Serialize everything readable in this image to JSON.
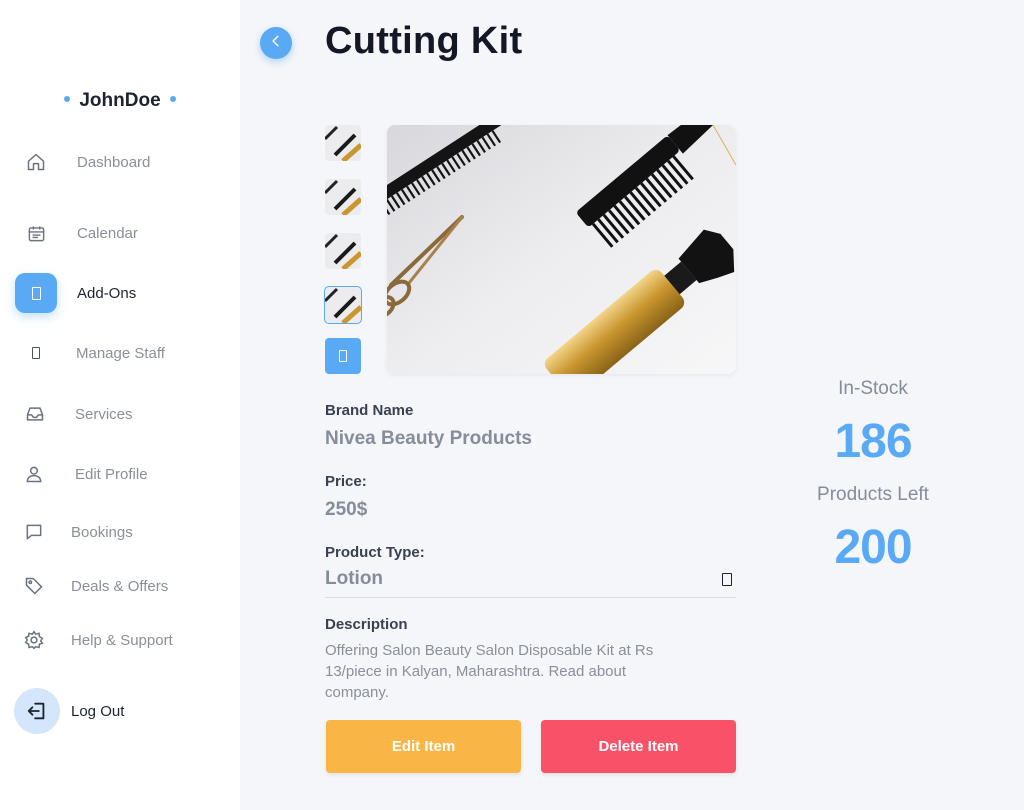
{
  "sidebar": {
    "user_name": "JohnDoe",
    "items": [
      {
        "label": "Dashboard",
        "icon": "home-icon"
      },
      {
        "label": "Calendar",
        "icon": "calendar-icon"
      },
      {
        "label": "Add-Ons",
        "icon": "add-ons-icon",
        "active": true
      },
      {
        "label": "Manage Staff",
        "icon": "staff-icon"
      },
      {
        "label": "Services",
        "icon": "inbox-icon"
      },
      {
        "label": "Edit Profile",
        "icon": "user-icon"
      },
      {
        "label": "Bookings",
        "icon": "chat-icon"
      },
      {
        "label": "Deals & Offers",
        "icon": "tag-icon"
      },
      {
        "label": "Help & Support",
        "icon": "gear-icon"
      }
    ],
    "logout_label": "Log Out"
  },
  "product": {
    "title": "Cutting Kit",
    "brand_label": "Brand Name",
    "brand_value": "Nivea Beauty Products",
    "price_label": "Price:",
    "price_value": "250$",
    "type_label": "Product Type:",
    "type_value": "Lotion",
    "description_label": "Description",
    "description": "Offering Salon Beauty Salon Disposable Kit at Rs 13/piece in Kalyan, Maharashtra. Read about company."
  },
  "actions": {
    "edit_label": "Edit Item",
    "delete_label": "Delete Item"
  },
  "stats": {
    "in_stock_label": "In-Stock",
    "in_stock_value": "186",
    "left_label": "Products Left",
    "left_value": "200"
  },
  "colors": {
    "accent": "#5aa9f5",
    "edit": "#f9b545",
    "delete": "#f95167"
  }
}
